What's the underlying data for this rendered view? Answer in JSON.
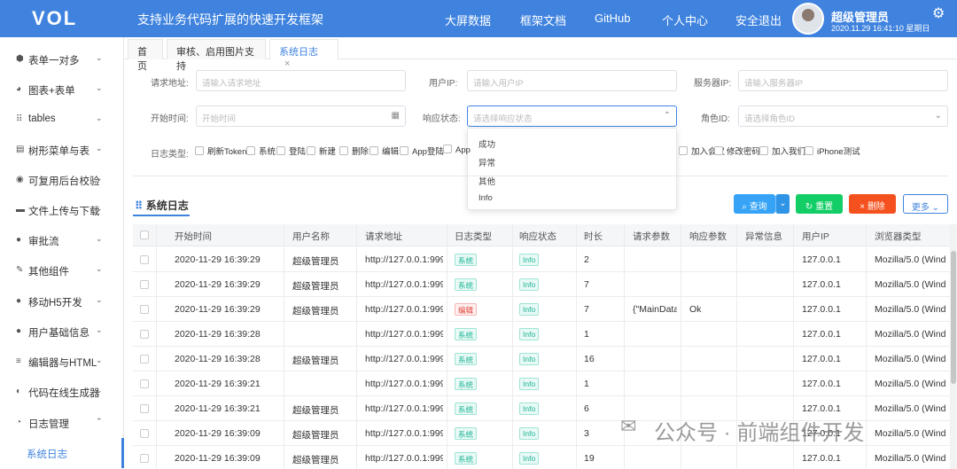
{
  "header": {
    "logo": "VOL",
    "slogan": "支持业务代码扩展的快速开发框架",
    "nav": [
      "大屏数据",
      "框架文档",
      "GitHub",
      "个人中心",
      "安全退出"
    ],
    "user_name": "超级管理员",
    "datetime": "2020.11.29 16:41:10 星期日"
  },
  "sidebar": {
    "items": [
      {
        "label": "表单一对多",
        "icon": "cube-icon",
        "chevron": "⌄"
      },
      {
        "label": "图表+表单",
        "icon": "chart-icon",
        "chevron": "⌄"
      },
      {
        "label": "tables",
        "icon": "grid-icon",
        "chevron": "⌄"
      },
      {
        "label": "树形菜单与表",
        "icon": "tree-icon",
        "chevron": "⌄"
      },
      {
        "label": "可复用后台校验",
        "icon": "rss-icon",
        "chevron": "⌄"
      },
      {
        "label": "文件上传与下载",
        "icon": "folder-icon",
        "chevron": "⌄"
      },
      {
        "label": "审批流",
        "icon": "flow-icon",
        "chevron": "⌄"
      },
      {
        "label": "其他组件",
        "icon": "wrench-icon",
        "chevron": "⌄"
      },
      {
        "label": "移动H5开发",
        "icon": "apple-icon",
        "chevron": "⌄"
      },
      {
        "label": "用户基础信息",
        "icon": "users-icon",
        "chevron": "⌄"
      },
      {
        "label": "编辑器与HTML",
        "icon": "sliders-icon",
        "chevron": "⌄"
      },
      {
        "label": "代码在线生成器",
        "icon": "code-icon",
        "chevron": "⌄"
      },
      {
        "label": "日志管理",
        "icon": "pie-icon",
        "chevron": "⌃"
      }
    ],
    "active_sub": "系统日志"
  },
  "tabs": [
    {
      "label": "首页"
    },
    {
      "label": "审核、启用图片支持"
    },
    {
      "label": "系统日志",
      "close": "×"
    }
  ],
  "filters": {
    "url_label": "请求地址:",
    "url_placeholder": "请输入请求地址",
    "ip_label": "用户IP:",
    "ip_placeholder": "请输入用户IP",
    "server_label": "服务器IP:",
    "server_placeholder": "请输入服务器IP",
    "start_label": "开始时间:",
    "start_placeholder": "开始时间",
    "status_label": "响应状态:",
    "status_placeholder": "请选择响应状态",
    "role_label": "角色ID:",
    "role_placeholder": "请选择角色ID",
    "logtype_label": "日志类型:",
    "logtypes": [
      "刷新Token",
      "系统",
      "登陆",
      "新建",
      "删除",
      "编辑",
      "App登陆",
      "App",
      "加入会议",
      "修改密码",
      "加入我们",
      "iPhone测试"
    ],
    "status_options": [
      "成功",
      "异常",
      "其他",
      "Info"
    ]
  },
  "section": {
    "title": "系统日志"
  },
  "buttons": {
    "search": "查询",
    "reset": "重置",
    "delete": "删除",
    "more": "更多"
  },
  "table": {
    "columns": [
      "开始时间",
      "用户名称",
      "请求地址",
      "日志类型",
      "响应状态",
      "时长",
      "请求参数",
      "响应参数",
      "异常信息",
      "用户IP",
      "浏览器类型"
    ],
    "rows": [
      {
        "time": "2020-11-29 16:39:29",
        "user": "超级管理员",
        "url": "http://127.0.0.1:9991/",
        "type": "系统",
        "status": "Info",
        "dur": "2",
        "req": "",
        "resp": "",
        "err": "",
        "ip": "127.0.0.1",
        "ua": "Mozilla/5.0 (Wind"
      },
      {
        "time": "2020-11-29 16:39:29",
        "user": "超级管理员",
        "url": "http://127.0.0.1:9991/",
        "type": "系统",
        "status": "Info",
        "dur": "7",
        "req": "",
        "resp": "",
        "err": "",
        "ip": "127.0.0.1",
        "ua": "Mozilla/5.0 (Wind"
      },
      {
        "time": "2020-11-29 16:39:29",
        "user": "超级管理员",
        "url": "http://127.0.0.1:9991/",
        "type": "编辑",
        "status": "Info",
        "dur": "7",
        "req": "{\"MainData\":",
        "resp": "Ok",
        "err": "",
        "ip": "127.0.0.1",
        "ua": "Mozilla/5.0 (Wind"
      },
      {
        "time": "2020-11-29 16:39:28",
        "user": "",
        "url": "http://127.0.0.1:9991/",
        "type": "系统",
        "status": "Info",
        "dur": "1",
        "req": "",
        "resp": "",
        "err": "",
        "ip": "127.0.0.1",
        "ua": "Mozilla/5.0 (Wind"
      },
      {
        "time": "2020-11-29 16:39:28",
        "user": "超级管理员",
        "url": "http://127.0.0.1:9991/",
        "type": "系统",
        "status": "Info",
        "dur": "16",
        "req": "",
        "resp": "",
        "err": "",
        "ip": "127.0.0.1",
        "ua": "Mozilla/5.0 (Wind"
      },
      {
        "time": "2020-11-29 16:39:21",
        "user": "",
        "url": "http://127.0.0.1:9991/",
        "type": "系统",
        "status": "Info",
        "dur": "1",
        "req": "",
        "resp": "",
        "err": "",
        "ip": "127.0.0.1",
        "ua": "Mozilla/5.0 (Wind"
      },
      {
        "time": "2020-11-29 16:39:21",
        "user": "超级管理员",
        "url": "http://127.0.0.1:9991/",
        "type": "系统",
        "status": "Info",
        "dur": "6",
        "req": "",
        "resp": "",
        "err": "",
        "ip": "127.0.0.1",
        "ua": "Mozilla/5.0 (Wind"
      },
      {
        "time": "2020-11-29 16:39:09",
        "user": "超级管理员",
        "url": "http://127.0.0.1:9991/",
        "type": "系统",
        "status": "Info",
        "dur": "3",
        "req": "",
        "resp": "",
        "err": "",
        "ip": "127.0.0.1",
        "ua": "Mozilla/5.0 (Wind"
      },
      {
        "time": "2020-11-29 16:39:09",
        "user": "超级管理员",
        "url": "http://127.0.0.1:9991/",
        "type": "系统",
        "status": "Info",
        "dur": "19",
        "req": "",
        "resp": "",
        "err": "",
        "ip": "127.0.0.1",
        "ua": "Mozilla/5.0 (Wind"
      }
    ]
  },
  "watermark": "公众号 · 前端组件开发",
  "colors": {
    "primary": "#3f83df",
    "search": "#36a3f7",
    "reset": "#13ce66",
    "delete": "#f4511e",
    "tag_green": "#1bb394",
    "tag_red": "#e0443c"
  }
}
